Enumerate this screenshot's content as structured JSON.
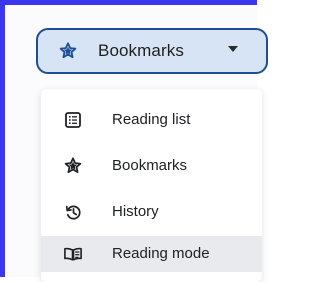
{
  "side_panel": {
    "selector": {
      "label": "Bookmarks",
      "icon": "bookmarks-star-icon"
    },
    "menu": {
      "items": [
        {
          "label": "Reading list",
          "icon": "reading-list-icon",
          "selected": false
        },
        {
          "label": "Bookmarks",
          "icon": "bookmarks-star-icon",
          "selected": false
        },
        {
          "label": "History",
          "icon": "history-icon",
          "selected": false
        },
        {
          "label": "Reading mode",
          "icon": "reading-mode-icon",
          "selected": true
        }
      ]
    }
  },
  "colors": {
    "frame_border": "#3b35f0",
    "dropdown_background": "#d7e4f6",
    "dropdown_border": "#1f4e93",
    "selected_item_background": "#e9eaed"
  }
}
